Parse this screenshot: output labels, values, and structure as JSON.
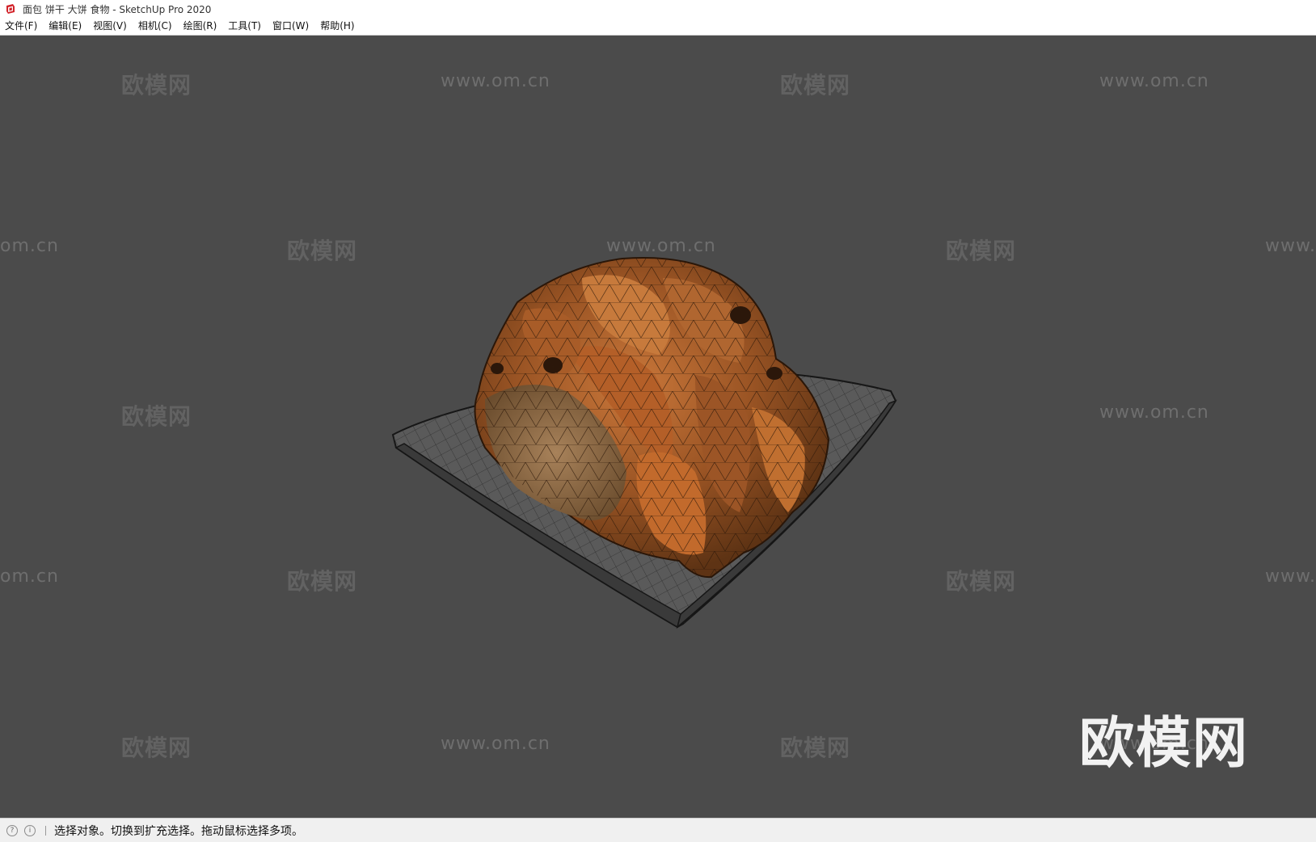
{
  "window": {
    "title": "面包 饼干 大饼 食物 - SketchUp Pro 2020",
    "app_icon": "sketchup-logo-icon",
    "accent": "#d2232a"
  },
  "menu": {
    "items": [
      "文件(F)",
      "编辑(E)",
      "视图(V)",
      "相机(C)",
      "绘图(R)",
      "工具(T)",
      "窗口(W)",
      "帮助(H)"
    ]
  },
  "viewport": {
    "background": "#4b4b4b",
    "model": "bread-plate-wireframe",
    "watermark_cn": "欧模网",
    "watermark_url": "www.om.cn",
    "watermark_url_partial_left": "om.cn",
    "watermark_url_partial_right": "www.",
    "watermark_logo": "欧模网"
  },
  "status": {
    "geo_icon": "geolocation-icon",
    "info_icon": "info-icon",
    "message": "选择对象。切换到扩充选择。拖动鼠标选择多项。"
  }
}
